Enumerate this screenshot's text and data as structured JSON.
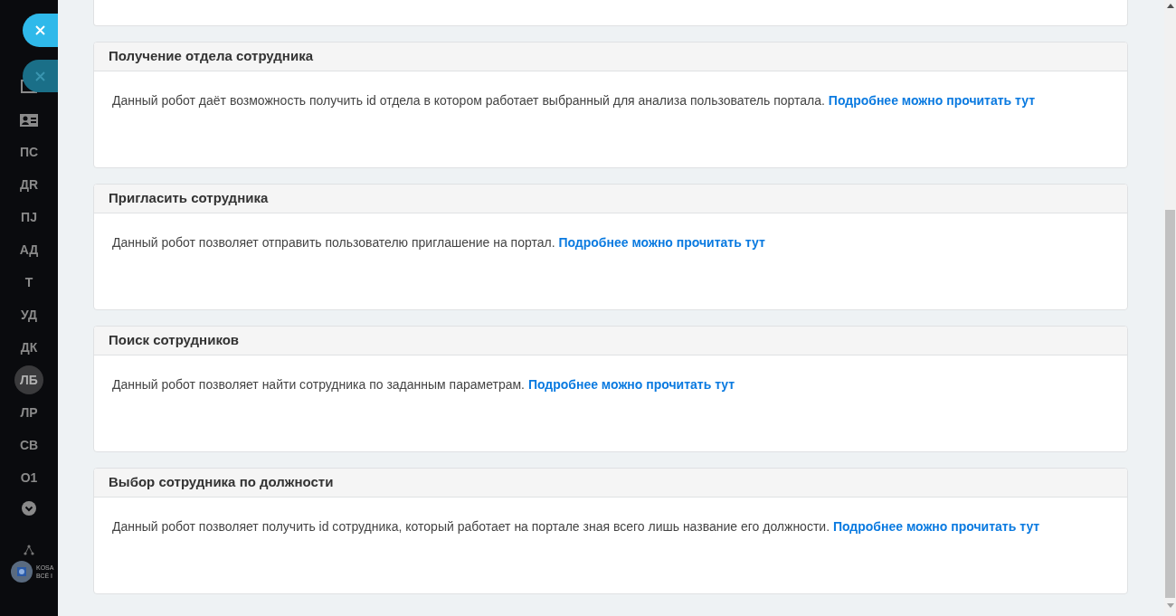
{
  "sidebar": {
    "items": [
      {
        "label": "ПС",
        "selected": false
      },
      {
        "label": "ДR",
        "selected": false
      },
      {
        "label": "ПЈ",
        "selected": false
      },
      {
        "label": "АД",
        "selected": false
      },
      {
        "label": "Т",
        "selected": false
      },
      {
        "label": "УД",
        "selected": false
      },
      {
        "label": "ДК",
        "selected": false
      },
      {
        "label": "ЛБ",
        "selected": true
      },
      {
        "label": "ЛР",
        "selected": false
      },
      {
        "label": "СВ",
        "selected": false
      },
      {
        "label": "О1",
        "selected": false
      }
    ],
    "company": {
      "name": "KOSA",
      "subtitle": "ВСЁ I"
    }
  },
  "cards": [
    {
      "title": "Получение отдела сотрудника",
      "text": "Данный робот даёт возможность получить id отдела в котором работает выбранный для анализа пользователь портала.",
      "link": "Подробнее можно прочитать тут"
    },
    {
      "title": "Пригласить сотрудника",
      "text": "Данный робот позволяет отправить пользователю приглашение на портал.",
      "link": "Подробнее можно прочитать тут"
    },
    {
      "title": "Поиск сотрудников",
      "text": "Данный робот позволяет найти сотрудника по заданным параметрам.",
      "link": "Подробнее можно прочитать тут"
    },
    {
      "title": "Выбор сотрудника по должности",
      "text": "Данный робот позволяет получить id сотрудника, который работает на портале зная всего лишь название его должности.",
      "link": "Подробнее можно прочитать тут"
    }
  ]
}
